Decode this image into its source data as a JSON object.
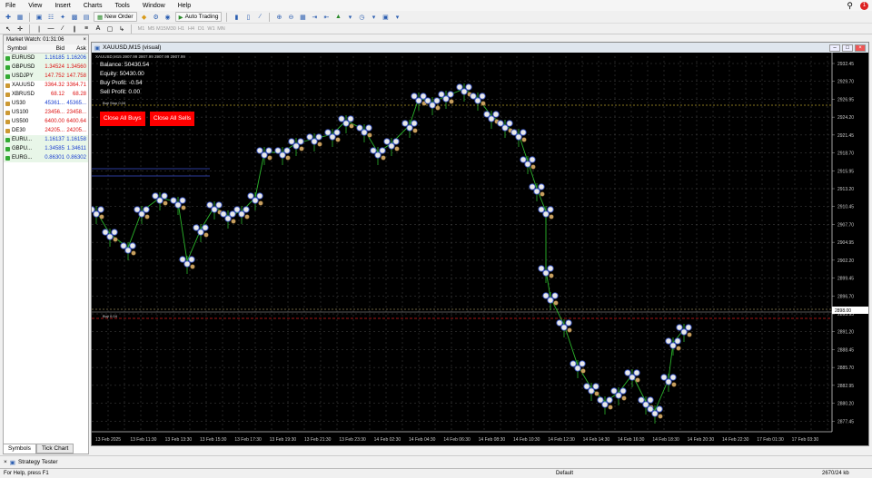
{
  "menu": [
    "File",
    "View",
    "Insert",
    "Charts",
    "Tools",
    "Window",
    "Help"
  ],
  "toolbar": {
    "new_order": "New Order",
    "auto_trading": "Auto Trading"
  },
  "timeframes": [
    "M1",
    "M5",
    "M15",
    "M30",
    "H1",
    "H4",
    "D1",
    "W1",
    "MN"
  ],
  "market_watch": {
    "title": "Market Watch: 01:31:06",
    "headers": {
      "symbol": "Symbol",
      "bid": "Bid",
      "ask": "Ask"
    },
    "rows": [
      {
        "symbol": "EURUSD",
        "bid": "1.16185",
        "ask": "1.16206",
        "dir": "up",
        "green": true
      },
      {
        "symbol": "GBPUSD",
        "bid": "1.34524",
        "ask": "1.34560",
        "dir": "down",
        "green": true
      },
      {
        "symbol": "USDJPY",
        "bid": "147.752",
        "ask": "147.758",
        "dir": "down",
        "green": true
      },
      {
        "symbol": "XAUUSD",
        "bid": "3364.32",
        "ask": "3364.71",
        "dir": "down",
        "green": false
      },
      {
        "symbol": "XBRUSD",
        "bid": "68.12",
        "ask": "68.28",
        "dir": "down",
        "green": false
      },
      {
        "symbol": "US30",
        "bid": "45361...",
        "ask": "45365...",
        "dir": "up",
        "green": false
      },
      {
        "symbol": "US100",
        "bid": "23456...",
        "ask": "23458...",
        "dir": "down",
        "green": false
      },
      {
        "symbol": "US500",
        "bid": "6400.00",
        "ask": "6400.64",
        "dir": "down",
        "green": false
      },
      {
        "symbol": "DE30",
        "bid": "24205...",
        "ask": "24205...",
        "dir": "down",
        "green": false
      },
      {
        "symbol": "EURU...",
        "bid": "1.16137",
        "ask": "1.16158",
        "dir": "up",
        "green": true
      },
      {
        "symbol": "GBPU...",
        "bid": "1.34585",
        "ask": "1.34611",
        "dir": "up",
        "green": true
      },
      {
        "symbol": "EURG...",
        "bid": "0.86301",
        "ask": "0.86302",
        "dir": "up",
        "green": true
      }
    ],
    "tabs": [
      "Symbols",
      "Tick Chart"
    ]
  },
  "chart": {
    "title": "XAUUSD,M15 (visual)",
    "header_line": "XAUUSD,M15  2907.99 2907.99 2907.99 2907.99",
    "info": {
      "balance": "Balance: 50430.54",
      "equity": "Equity: 50430.00",
      "buy_profit": "Buy Profit: -0.54",
      "sell_profit": "Sell Profit: 0.00"
    },
    "buttons": {
      "close_buys": "Close All Buys",
      "close_sells": "Close All Sells"
    },
    "price_labels": [
      "2932.45",
      "2929.70",
      "2926.95",
      "2924.20",
      "2921.45",
      "2918.70",
      "2915.95",
      "2913.20",
      "2910.45",
      "2907.70",
      "2904.95",
      "2902.20",
      "2899.45",
      "2896.70",
      "2893.95",
      "2891.20",
      "2888.45",
      "2885.70",
      "2882.95",
      "2880.20",
      "2877.45"
    ],
    "current_price": "2898.00",
    "time_labels": [
      "13 Feb 2025",
      "13 Feb 11:30",
      "13 Feb 13:30",
      "13 Feb 15:30",
      "13 Feb 17:30",
      "13 Feb 19:30",
      "13 Feb 21:30",
      "13 Feb 23:30",
      "14 Feb 02:30",
      "14 Feb 04:30",
      "14 Feb 06:30",
      "14 Feb 08:30",
      "14 Feb 10:30",
      "14 Feb 12:30",
      "14 Feb 14:30",
      "14 Feb 16:30",
      "14 Feb 18:30",
      "14 Feb 20:30",
      "14 Feb 22:30",
      "17 Feb 01:30",
      "17 Feb 03:30"
    ],
    "level_labels": [
      "Buy Stop 0.04",
      "Buy 0.04"
    ]
  },
  "bottom": {
    "strategy_tester": "Strategy Tester"
  },
  "status": {
    "help": "For Help, press F1",
    "profile": "Default",
    "traffic": "2670/24 kb"
  }
}
